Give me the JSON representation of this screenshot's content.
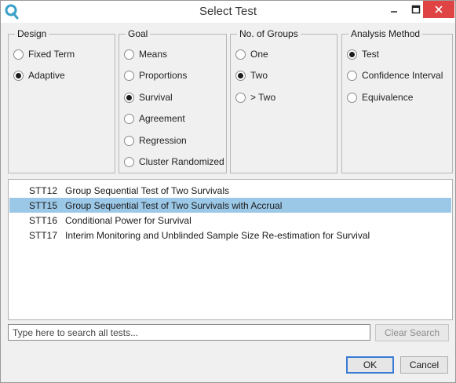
{
  "window": {
    "title": "Select Test"
  },
  "groups": {
    "design": {
      "title": "Design",
      "options": [
        {
          "label": "Fixed Term",
          "selected": false
        },
        {
          "label": "Adaptive",
          "selected": true
        }
      ]
    },
    "goal": {
      "title": "Goal",
      "options": [
        {
          "label": "Means",
          "selected": false
        },
        {
          "label": "Proportions",
          "selected": false
        },
        {
          "label": "Survival",
          "selected": true
        },
        {
          "label": "Agreement",
          "selected": false
        },
        {
          "label": "Regression",
          "selected": false
        },
        {
          "label": "Cluster Randomized",
          "selected": false
        }
      ]
    },
    "groups_count": {
      "title": "No. of Groups",
      "options": [
        {
          "label": "One",
          "selected": false
        },
        {
          "label": "Two",
          "selected": true
        },
        {
          "label": "> Two",
          "selected": false
        }
      ]
    },
    "analysis": {
      "title": "Analysis Method",
      "options": [
        {
          "label": "Test",
          "selected": true
        },
        {
          "label": "Confidence Interval",
          "selected": false
        },
        {
          "label": "Equivalence",
          "selected": false
        }
      ]
    }
  },
  "tests": [
    {
      "code": "STT12",
      "name": "Group Sequential Test of Two Survivals",
      "selected": false
    },
    {
      "code": "STT15",
      "name": "Group Sequential Test of Two Survivals with Accrual",
      "selected": true
    },
    {
      "code": "STT16",
      "name": "Conditional Power for Survival",
      "selected": false
    },
    {
      "code": "STT17",
      "name": "Interim Monitoring and Unblinded Sample Size Re-estimation for Survival",
      "selected": false
    }
  ],
  "search": {
    "placeholder": "Type here to search all tests...",
    "clear_label": "Clear Search"
  },
  "buttons": {
    "ok_label": "OK",
    "cancel_label": "Cancel"
  },
  "colors": {
    "selection": "#9cc8e8",
    "close_button": "#e04343",
    "accent": "#3a7bd5"
  }
}
